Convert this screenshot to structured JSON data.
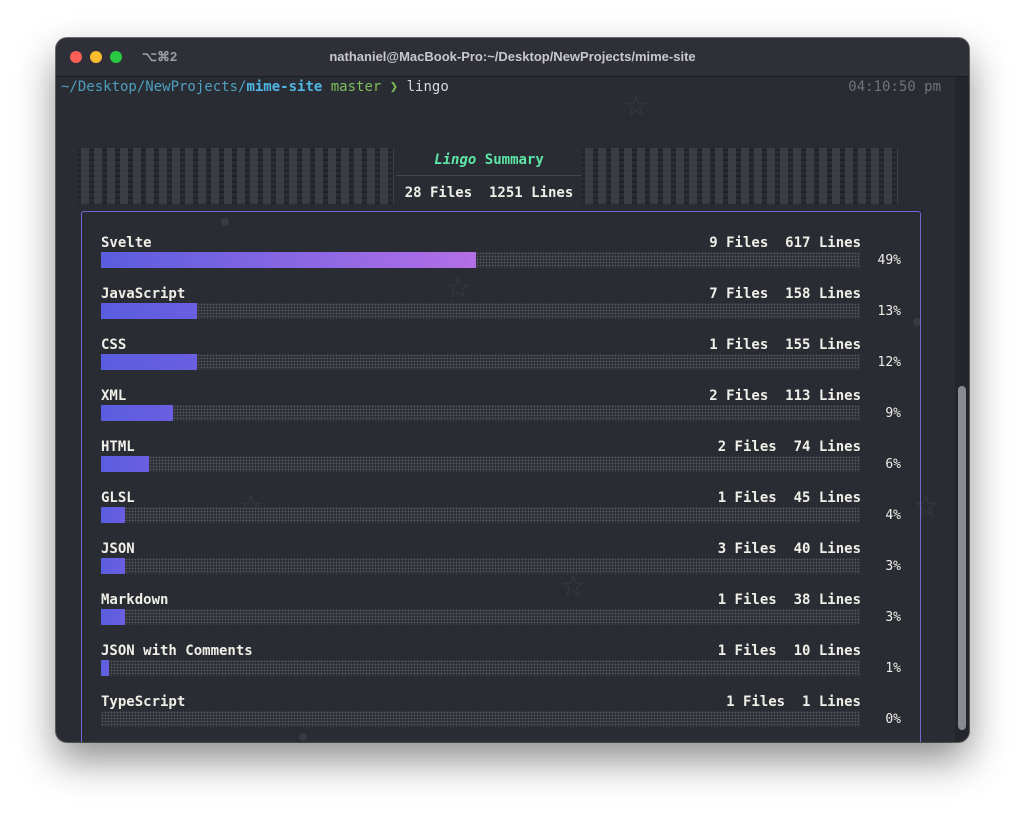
{
  "window": {
    "shortcut": "⌥⌘2",
    "title": "nathaniel@MacBook-Pro:~/Desktop/NewProjects/mime-site"
  },
  "prompt": {
    "path": "~/Desktop/NewProjects/",
    "dir": "mime-site",
    "branch": "master",
    "arrow": "❯",
    "command": "lingo",
    "time": "04:10:50 pm"
  },
  "summary": {
    "title_italic": "Lingo",
    "title_rest": "Summary",
    "files": "28 Files",
    "lines": "1251 Lines"
  },
  "colors": {
    "accent_green": "#5ee6a8",
    "border_purple": "#7b62d6",
    "bar_start": "#5a5ddf",
    "bar_end": "#b36fe6"
  },
  "languages": [
    {
      "name": "Svelte",
      "files": "9 Files",
      "lines": "617 Lines",
      "percent": "49%",
      "fraction": 0.494
    },
    {
      "name": "JavaScript",
      "files": "7 Files",
      "lines": "158 Lines",
      "percent": "13%",
      "fraction": 0.126
    },
    {
      "name": "CSS",
      "files": "1 Files",
      "lines": "155 Lines",
      "percent": "12%",
      "fraction": 0.126
    },
    {
      "name": "XML",
      "files": "2 Files",
      "lines": "113 Lines",
      "percent": "9%",
      "fraction": 0.095
    },
    {
      "name": "HTML",
      "files": "2 Files",
      "lines": "74 Lines",
      "percent": "6%",
      "fraction": 0.063
    },
    {
      "name": "GLSL",
      "files": "1 Files",
      "lines": "45 Lines",
      "percent": "4%",
      "fraction": 0.032
    },
    {
      "name": "JSON",
      "files": "3 Files",
      "lines": "40 Lines",
      "percent": "3%",
      "fraction": 0.032
    },
    {
      "name": "Markdown",
      "files": "1 Files",
      "lines": "38 Lines",
      "percent": "3%",
      "fraction": 0.032
    },
    {
      "name": "JSON with Comments",
      "files": "1 Files",
      "lines": "10 Lines",
      "percent": "1%",
      "fraction": 0.011
    },
    {
      "name": "TypeScript",
      "files": "1 Files",
      "lines": "1 Lines",
      "percent": "0%",
      "fraction": 0.0
    }
  ]
}
